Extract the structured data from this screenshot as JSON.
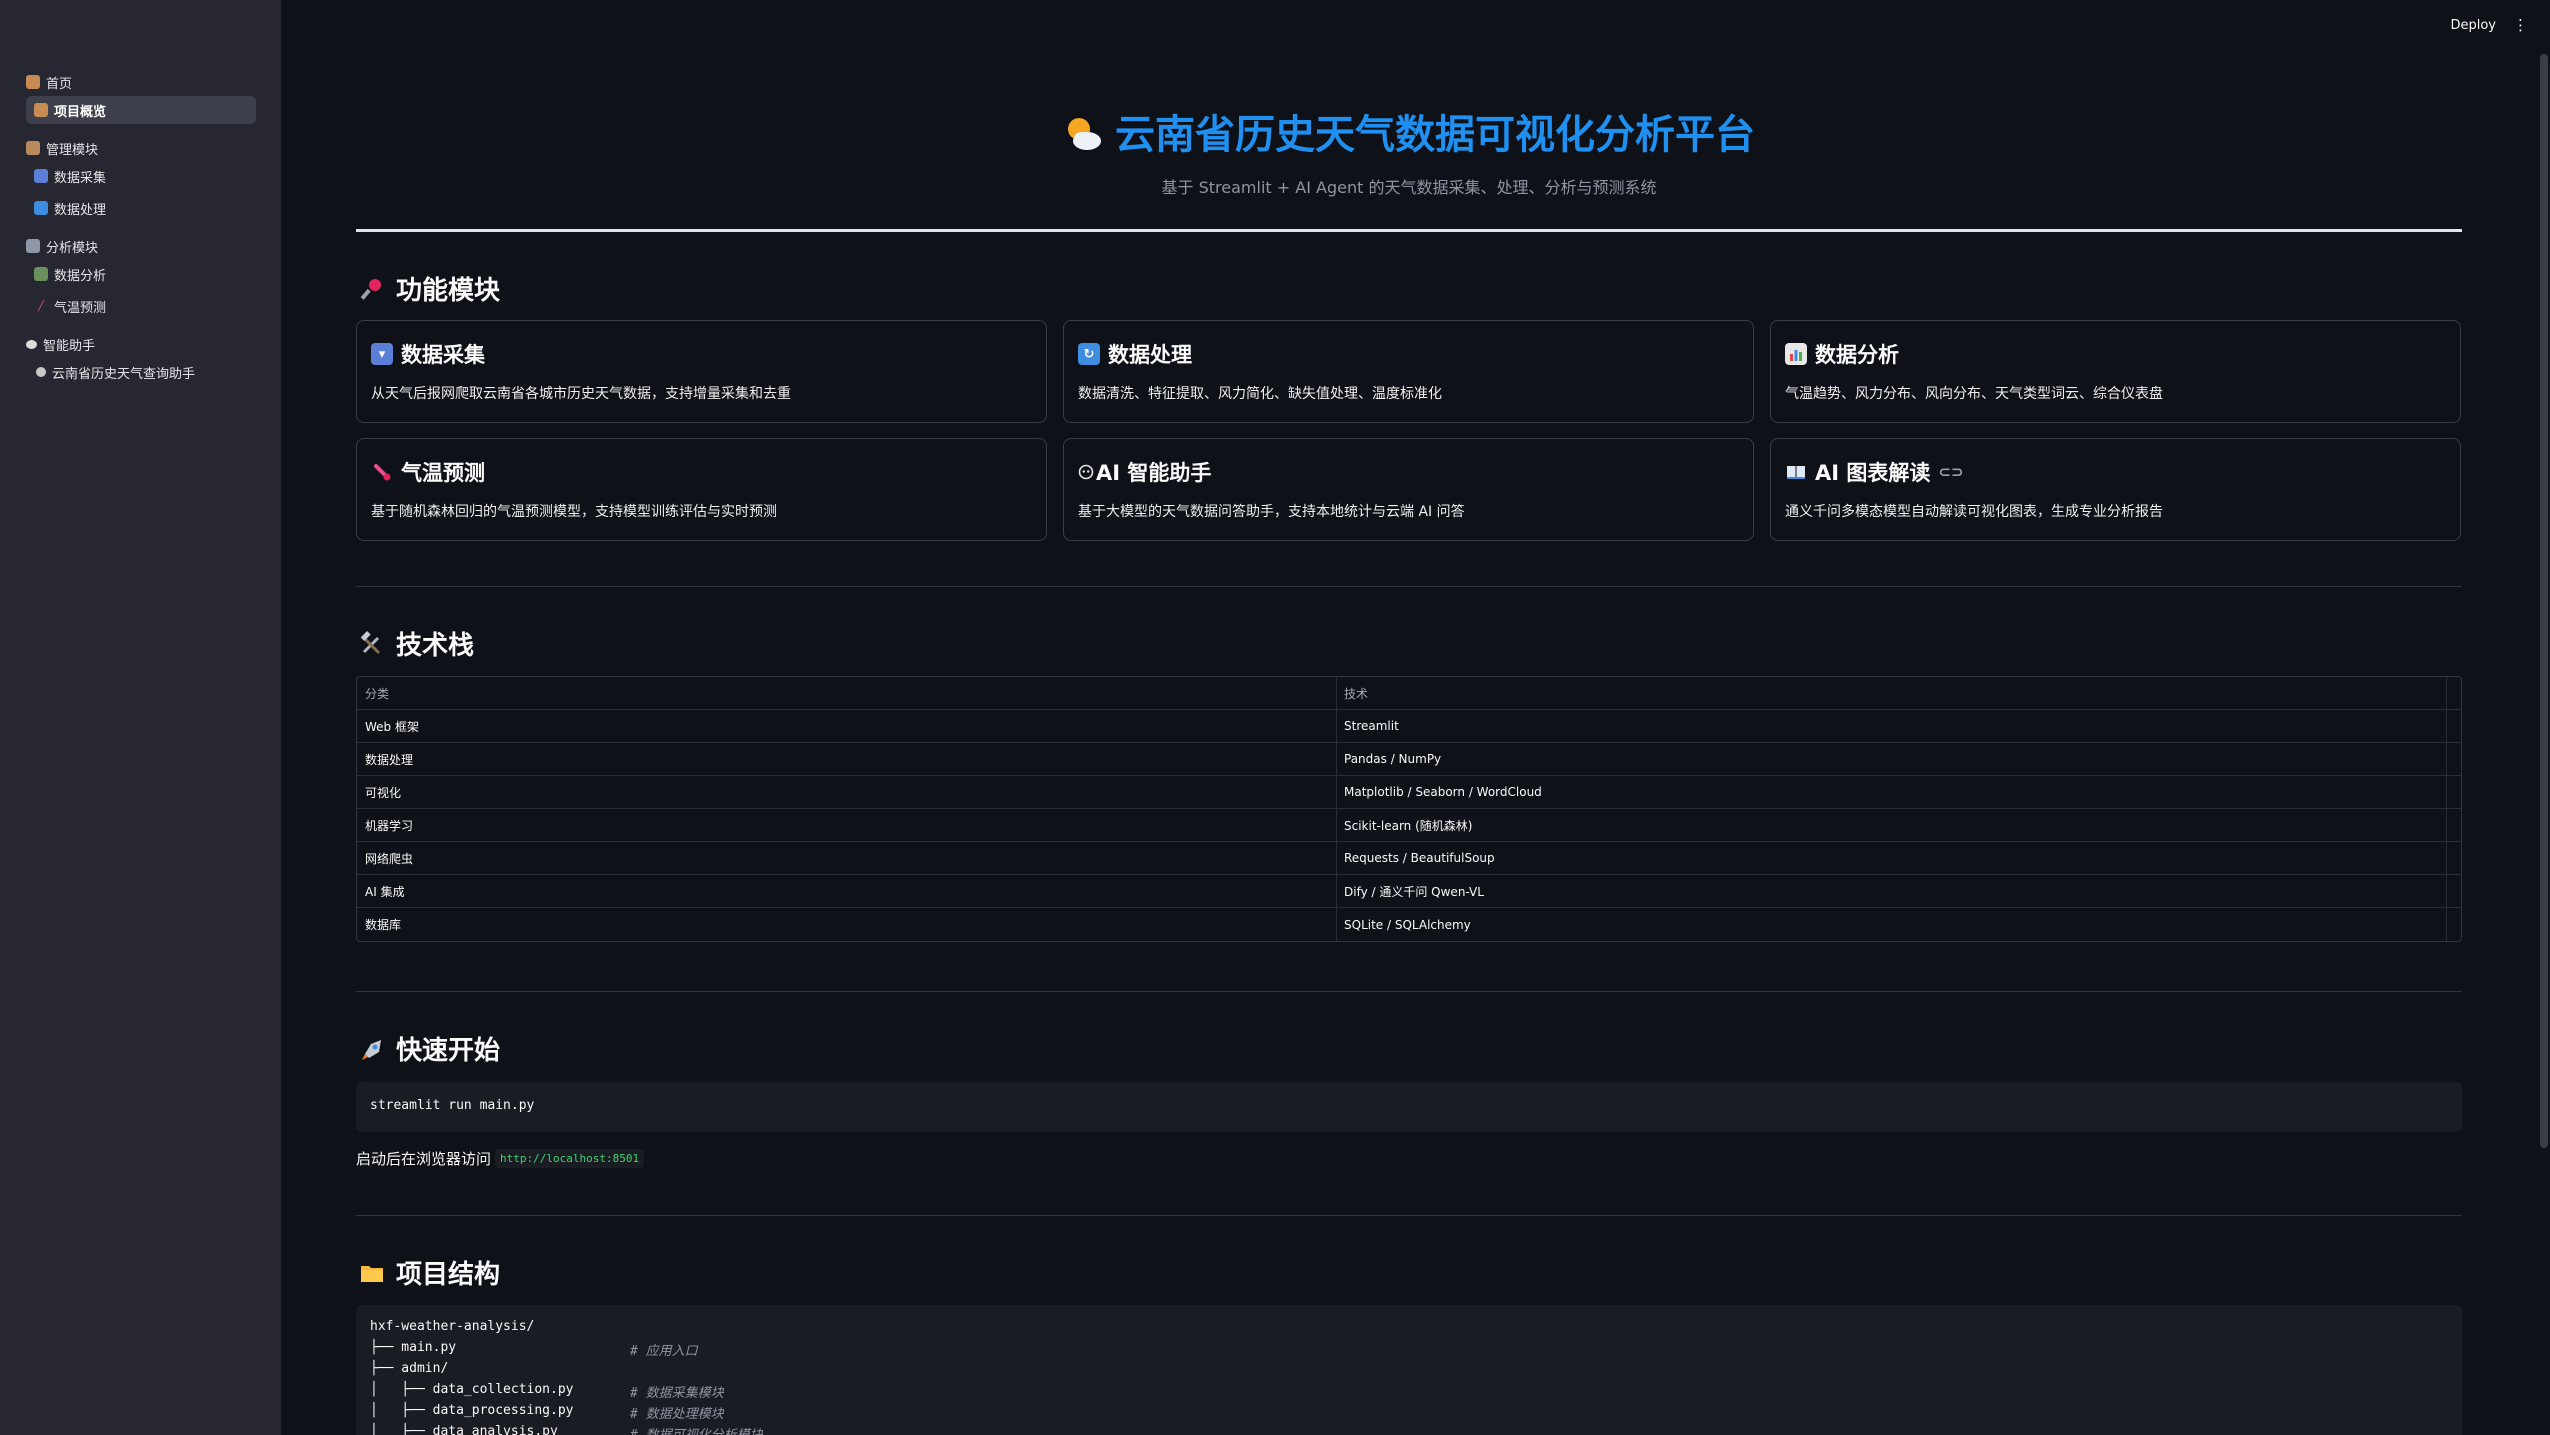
{
  "topbar": {
    "deploy_label": "Deploy",
    "menu_icon": "kebab-icon"
  },
  "sidebar": {
    "items": [
      {
        "label": "首页",
        "icon": "house-icon",
        "type": "group"
      },
      {
        "label": "项目概览",
        "icon": "house-icon",
        "type": "item",
        "active": true
      },
      {
        "label": "管理模块",
        "icon": "clipboard-icon",
        "type": "group"
      },
      {
        "label": "数据采集",
        "icon": "inbox-icon",
        "type": "item"
      },
      {
        "label": "数据处理",
        "icon": "refresh-icon",
        "type": "item"
      },
      {
        "label": "分析模块",
        "icon": "chart-icon",
        "type": "group"
      },
      {
        "label": "数据分析",
        "icon": "bar-chart-icon",
        "type": "item"
      },
      {
        "label": "气温预测",
        "icon": "thermometer-icon",
        "type": "item"
      },
      {
        "label": "智能助手",
        "icon": "speech-bubble-icon",
        "type": "group"
      },
      {
        "label": "云南省历史天气查询助手",
        "icon": "robot-icon",
        "type": "item"
      }
    ]
  },
  "header": {
    "title": "云南省历史天气数据可视化分析平台",
    "subtitle": "基于 Streamlit + AI Agent 的天气数据采集、处理、分析与预测系统"
  },
  "features": {
    "heading": "功能模块",
    "cards": [
      {
        "title": "数据采集",
        "desc": "从天气后报网爬取云南省各城市历史天气数据，支持增量采集和去重",
        "icon": "inbox-icon"
      },
      {
        "title": "数据处理",
        "desc": "数据清洗、特征提取、风力简化、缺失值处理、温度标准化",
        "icon": "refresh-icon"
      },
      {
        "title": "数据分析",
        "desc": "气温趋势、风力分布、风向分布、天气类型词云、综合仪表盘",
        "icon": "bar-chart-icon"
      },
      {
        "title": "气温预测",
        "desc": "基于随机森林回归的气温预测模型，支持模型训练评估与实时预测",
        "icon": "thermometer-icon"
      },
      {
        "title": "AI 智能助手",
        "desc": "基于大模型的天气数据问答助手，支持本地统计与云端 AI 问答",
        "icon": "robot-icon"
      },
      {
        "title": "AI 图表解读",
        "desc": "通义千问多模态模型自动解读可视化图表，生成专业分析报告",
        "icon": "book-icon"
      }
    ]
  },
  "tech": {
    "heading": "技术栈",
    "columns": [
      "分类",
      "技术"
    ],
    "rows": [
      [
        "Web 框架",
        "Streamlit"
      ],
      [
        "数据处理",
        "Pandas / NumPy"
      ],
      [
        "可视化",
        "Matplotlib / Seaborn / WordCloud"
      ],
      [
        "机器学习",
        "Scikit-learn (随机森林)"
      ],
      [
        "网络爬虫",
        "Requests / BeautifulSoup"
      ],
      [
        "AI 集成",
        "Dify / 通义千问 Qwen-VL"
      ],
      [
        "数据库",
        "SQLite / SQLAlchemy"
      ]
    ]
  },
  "quickstart": {
    "heading": "快速开始",
    "command": "streamlit run main.py",
    "visit_text": "启动后在浏览器访问",
    "url": "http://localhost:8501"
  },
  "structure": {
    "heading": "项目结构",
    "root": "hxf-weather-analysis/",
    "lines": [
      {
        "path": "├── main.py",
        "comment": "# 应用入口"
      },
      {
        "path": "├── admin/",
        "comment": ""
      },
      {
        "path": "│   ├── data_collection.py",
        "comment": "# 数据采集模块"
      },
      {
        "path": "│   ├── data_processing.py",
        "comment": "# 数据处理模块"
      },
      {
        "path": "│   ├── data_analysis.py",
        "comment": "# 数据可视化分析模块"
      }
    ]
  },
  "colors": {
    "accent": "#1f8ff0",
    "sidebar_bg": "#262730",
    "main_bg": "#0e1117",
    "code_green": "#3dd56d"
  }
}
